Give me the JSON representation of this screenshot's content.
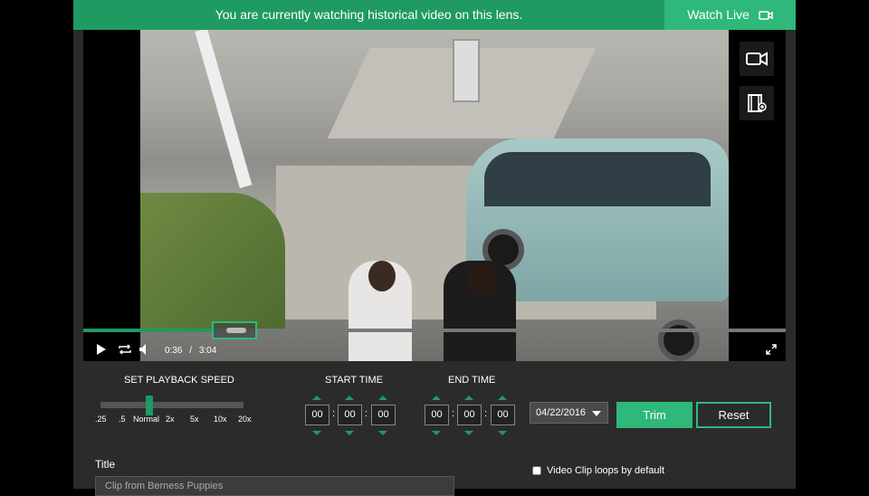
{
  "banner": {
    "message": "You are currently watching historical video on this lens.",
    "watch_live_label": "Watch Live"
  },
  "player": {
    "current_time": "0:36",
    "time_separator": "/",
    "duration": "3:04",
    "progress": 0.196,
    "side_buttons": [
      "video-camera-icon",
      "film-clip-icon"
    ]
  },
  "speed": {
    "label": "SET PLAYBACK SPEED",
    "options": [
      ".25",
      ".5",
      "Normal",
      "2x",
      "5x",
      "10x",
      "20x"
    ],
    "selected": "Normal"
  },
  "start_time": {
    "label": "START TIME",
    "hh": "00",
    "mm": "00",
    "ss": "00"
  },
  "end_time": {
    "label": "END TIME",
    "hh": "00",
    "mm": "00",
    "ss": "00"
  },
  "date": {
    "value": "04/22/2016"
  },
  "buttons": {
    "trim": "Trim",
    "reset": "Reset"
  },
  "clip": {
    "title_label": "Title",
    "title_value": "Clip from Berness Puppies",
    "loop_label": "Video Clip loops by default"
  },
  "colors": {
    "accent": "#2eb879",
    "banner": "#1f9a63",
    "panel": "#2b2b2b"
  }
}
